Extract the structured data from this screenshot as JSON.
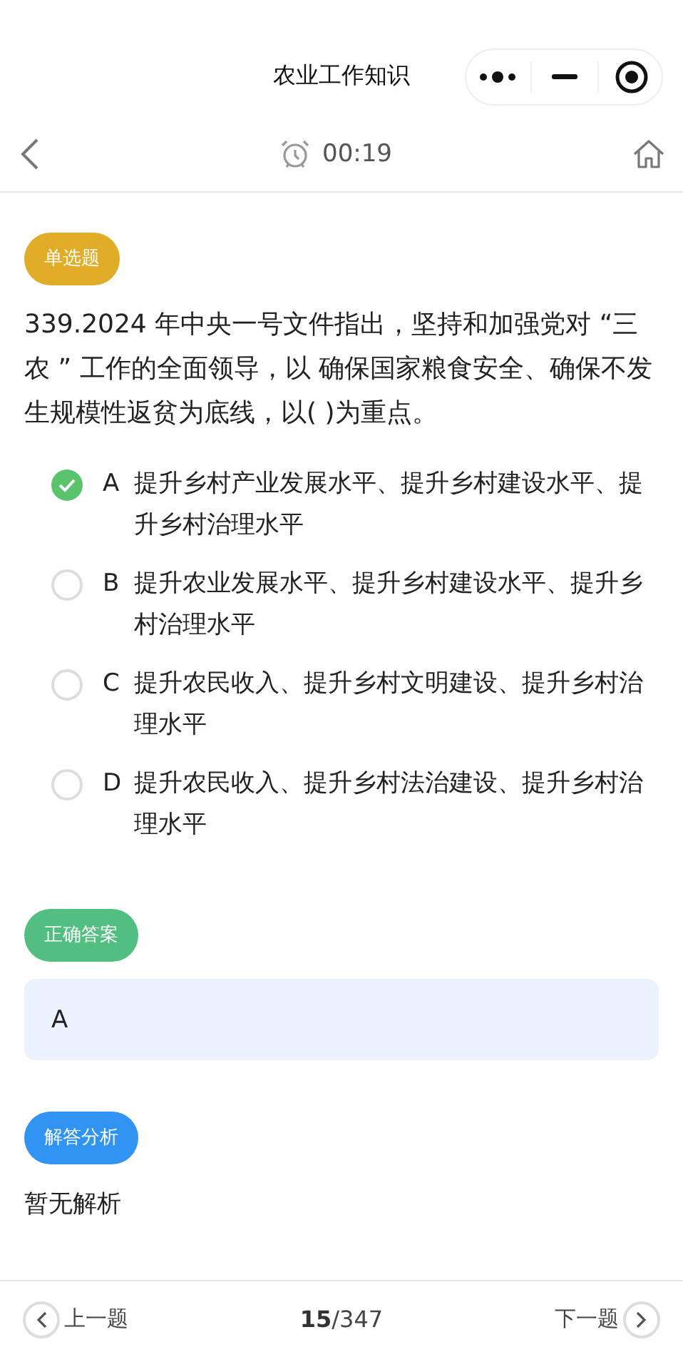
{
  "window": {
    "title": "农业工作知识"
  },
  "nav": {
    "timer": "00:19"
  },
  "question": {
    "type_tag": "单选题",
    "text": "339.2024 年中央一号文件指出，坚持和加强党对 “三农 ” 工作的全面领导，以 确保国家粮食安全、确保不发生规模性返贫为底线，以( )为重点。",
    "options": [
      {
        "letter": "A",
        "text": "提升乡村产业发展水平、提升乡村建设水平、提升乡村治理水平",
        "selected": true
      },
      {
        "letter": "B",
        "text": "提升农业发展水平、提升乡村建设水平、提升乡村治理水平",
        "selected": false
      },
      {
        "letter": "C",
        "text": "提升农民收入、提升乡村文明建设、提升乡村治理水平",
        "selected": false
      },
      {
        "letter": "D",
        "text": "提升农民收入、提升乡村法治建设、提升乡村治理水平",
        "selected": false
      }
    ]
  },
  "answer": {
    "tag": "正确答案",
    "value": "A"
  },
  "analysis": {
    "tag": "解答分析",
    "text": "暂无解析"
  },
  "footer": {
    "prev": "上一题",
    "current": "15",
    "total": "/347",
    "next": "下一题"
  }
}
